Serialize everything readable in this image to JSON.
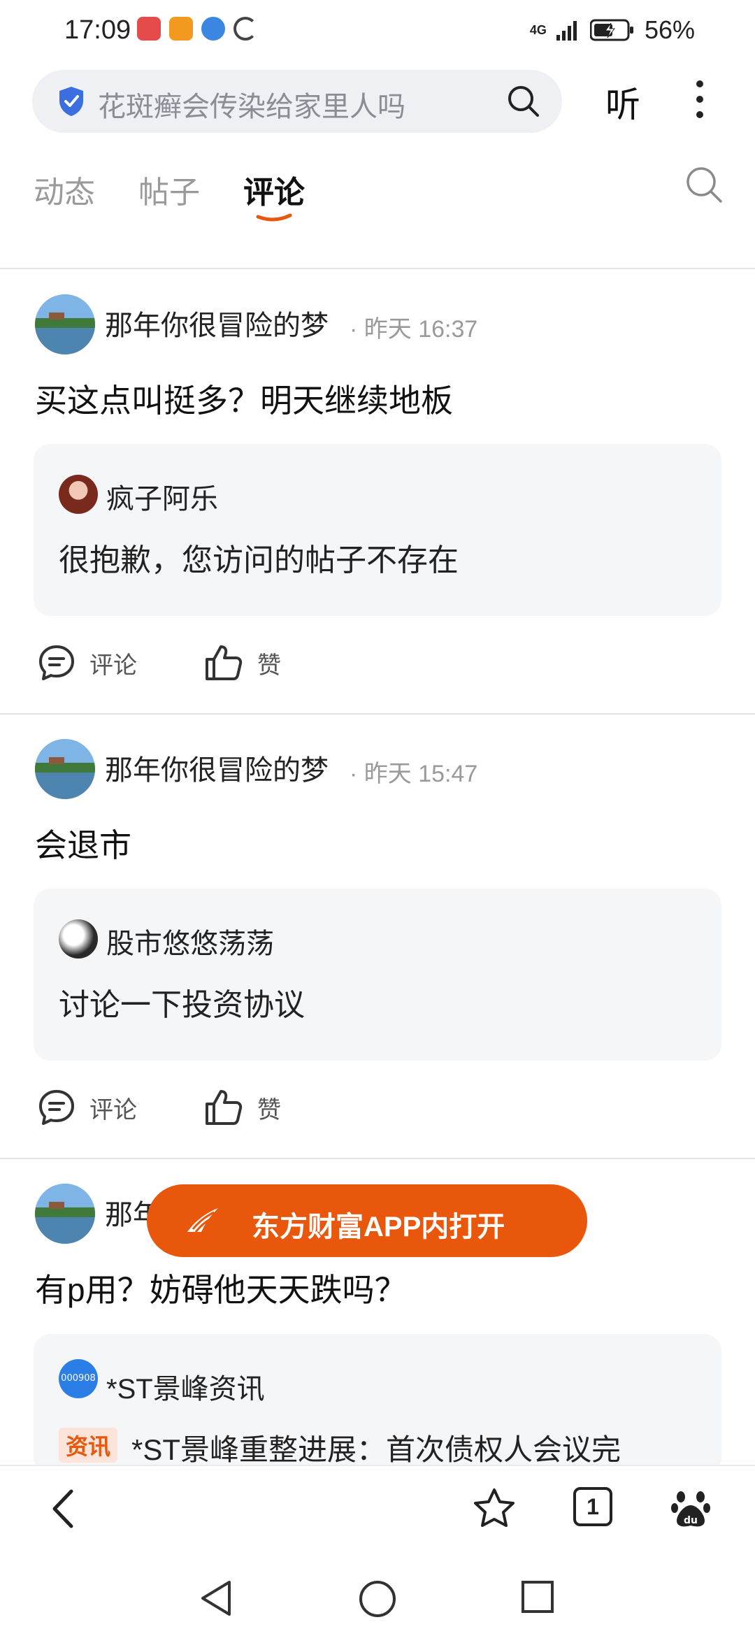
{
  "status_bar": {
    "time": "17:09",
    "battery": "56%",
    "network": "4G"
  },
  "top_bar": {
    "search_text": "花斑癣会传染给家里人吗",
    "listen_label": "听"
  },
  "tabs": [
    {
      "label": "动态",
      "active": false
    },
    {
      "label": "帖子",
      "active": false
    },
    {
      "label": "评论",
      "active": true
    }
  ],
  "actions": {
    "comment_label": "评论",
    "like_label": "赞"
  },
  "posts": [
    {
      "username": "那年你很冒险的梦",
      "time": "· 昨天 16:37",
      "text": "买这点叫挺多？明天继续地板",
      "quote_user": "疯子阿乐",
      "quote_text": "很抱歉，您访问的帖子不存在"
    },
    {
      "username": "那年你很冒险的梦",
      "time": "· 昨天 15:47",
      "text": "会退市",
      "quote_user": "股市悠悠荡荡",
      "quote_text": "讨论一下投资协议"
    },
    {
      "username": "那年",
      "text": "有p用？妨碍他天天跌吗？",
      "quote_user": "*ST景峰资讯",
      "quote_badge": "000908",
      "quote_tag": "资讯",
      "quote_text": "*ST景峰重整进展：首次债权人会议完"
    }
  ],
  "open_app": {
    "label": "东方财富APP内打开"
  },
  "browser_nav": {
    "tab_count": "1"
  },
  "colors": {
    "accent": "#e8570c",
    "shield": "#3b6fe0",
    "quote_bg": "#f5f6f8"
  }
}
